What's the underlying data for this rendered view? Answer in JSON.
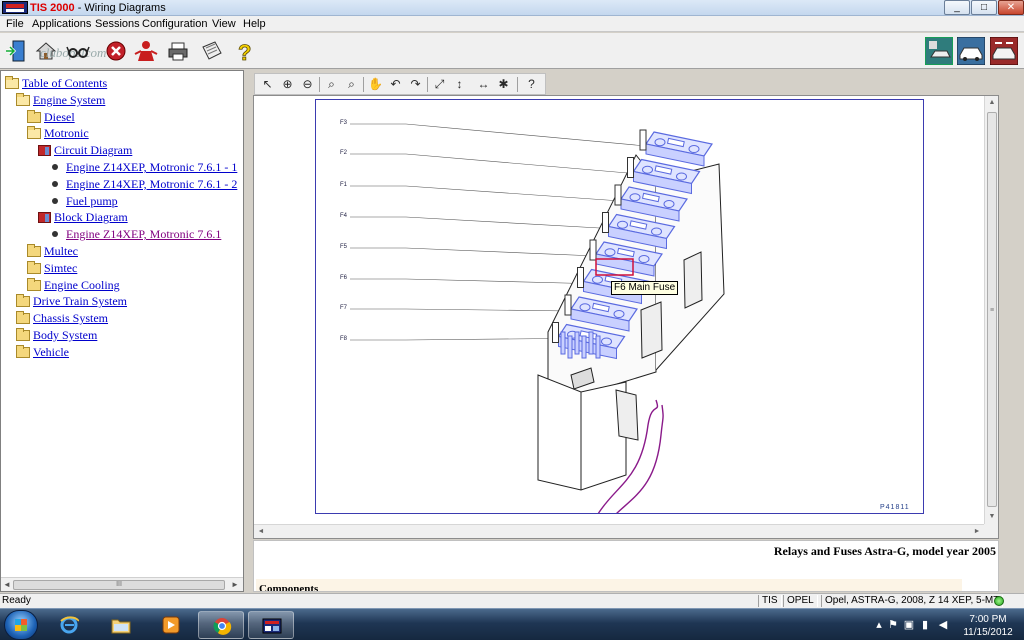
{
  "window": {
    "app_name": "TIS 2000",
    "title_rest": " - Wiring Diagrams",
    "minimize_glyph": "_",
    "maximize_glyph": "□",
    "close_glyph": "✕"
  },
  "menu": [
    "File",
    "Applications",
    "Sessions",
    "Configuration",
    "View",
    "Help"
  ],
  "toolbar": {
    "watermark": "clubopelcom",
    "icons": [
      "exit-icon",
      "home-icon",
      "glasses-icon",
      "stop-icon",
      "person-icon",
      "printer-icon",
      "notepad-icon",
      "help-icon",
      "car-diagnostic-icon",
      "car-wash-icon",
      "car-tools-icon"
    ]
  },
  "tree": {
    "items": [
      {
        "label": "Table of Contents",
        "icon": "folder-open",
        "indent": 0,
        "visited": false
      },
      {
        "label": "Engine System",
        "icon": "folder-open",
        "indent": 1,
        "visited": false
      },
      {
        "label": "Diesel",
        "icon": "folder",
        "indent": 2,
        "visited": false
      },
      {
        "label": "Motronic",
        "icon": "folder-open",
        "indent": 2,
        "visited": false
      },
      {
        "label": "Circuit Diagram",
        "icon": "book",
        "indent": 3,
        "visited": false
      },
      {
        "label": "Engine Z14XEP, Motronic 7.6.1 - 1",
        "icon": "bullet",
        "indent": 4,
        "visited": false
      },
      {
        "label": "Engine Z14XEP, Motronic 7.6.1 - 2",
        "icon": "bullet",
        "indent": 4,
        "visited": false
      },
      {
        "label": "Fuel pump",
        "icon": "bullet",
        "indent": 4,
        "visited": false
      },
      {
        "label": "Block Diagram",
        "icon": "book",
        "indent": 3,
        "visited": false
      },
      {
        "label": "Engine Z14XEP, Motronic 7.6.1",
        "icon": "bullet",
        "indent": 4,
        "visited": true
      },
      {
        "label": "Multec",
        "icon": "folder",
        "indent": 2,
        "visited": false
      },
      {
        "label": "Simtec",
        "icon": "folder",
        "indent": 2,
        "visited": false
      },
      {
        "label": "Engine Cooling",
        "icon": "folder",
        "indent": 2,
        "visited": false
      },
      {
        "label": "Drive Train System",
        "icon": "folder",
        "indent": 1,
        "visited": false
      },
      {
        "label": "Chassis System",
        "icon": "folder",
        "indent": 1,
        "visited": false
      },
      {
        "label": "Body System",
        "icon": "folder",
        "indent": 1,
        "visited": false
      },
      {
        "label": "Vehicle",
        "icon": "folder",
        "indent": 1,
        "visited": false
      }
    ],
    "scroll_left_glyph": "◄",
    "scroll_right_glyph": "►",
    "scroll_thumb_glyph": "III"
  },
  "viewer_toolbar": {
    "tools": [
      {
        "name": "select-tool",
        "glyph": "↖"
      },
      {
        "name": "zoom-in-tool",
        "glyph": "⊕"
      },
      {
        "name": "zoom-out-tool",
        "glyph": "⊖"
      },
      {
        "name": "zoom-tool",
        "glyph": "⌕"
      },
      {
        "name": "zoom-area-tool",
        "glyph": "⌕"
      },
      {
        "name": "pan-hand-tool",
        "glyph": "✋"
      },
      {
        "name": "rotate-left-tool",
        "glyph": "↶"
      },
      {
        "name": "rotate-right-tool",
        "glyph": "↷"
      },
      {
        "name": "fit-page-tool",
        "glyph": "⤢"
      },
      {
        "name": "fit-height-tool",
        "glyph": "↕"
      },
      {
        "name": "fit-width-tool",
        "glyph": "↔"
      },
      {
        "name": "mark-tool",
        "glyph": "✱"
      },
      {
        "name": "help-tool",
        "glyph": "?"
      }
    ]
  },
  "diagram": {
    "fuse_labels": [
      "F3",
      "F2",
      "F1",
      "F4",
      "F5",
      "F6",
      "F7",
      "F8"
    ],
    "tooltip": "F6 Main Fuse",
    "reference_code": "P41811",
    "scroll_up_glyph": "▲",
    "scroll_down_glyph": "▼",
    "scroll_left_glyph": "◄",
    "scroll_right_glyph": "►",
    "scroll_thumb_glyph": "≡"
  },
  "document": {
    "title": "Relays and Fuses Astra-G, model year 2005",
    "section_heading": "Components"
  },
  "status": {
    "text": "Ready",
    "cells": [
      "TIS",
      "OPEL",
      "Opel, ASTRA-G, 2008, Z 14 XEP, 5-MT"
    ]
  },
  "taskbar": {
    "apps": [
      "internet-explorer-icon",
      "explorer-folder-icon",
      "media-player-icon",
      "chrome-icon",
      "tis2000-icon"
    ],
    "time": "7:00 PM",
    "date": "11/15/2012"
  },
  "colors": {
    "link": "#0000cc",
    "visited_link": "#800080",
    "diagram_border": "#3b3bb0",
    "fuse_highlight": "#d0103a",
    "fuse_fill": "#5a6ae0"
  }
}
